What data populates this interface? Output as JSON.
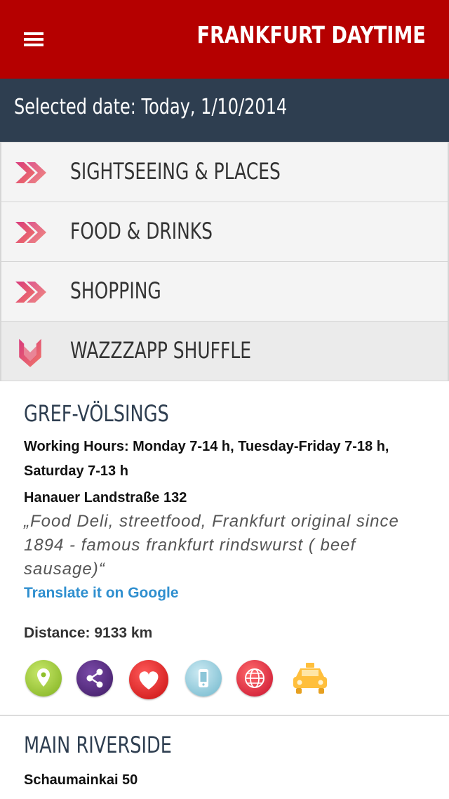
{
  "header": {
    "title": "FRANKFURT DAYTIME",
    "menu_icon": "hamburger-menu-icon"
  },
  "date_bar": {
    "text": "Selected date: Today, 1/10/2014"
  },
  "categories": [
    {
      "label": "SIGHTSEEING & PLACES",
      "icon": "chevron-right-icon",
      "expanded": false
    },
    {
      "label": "FOOD & DRINKS",
      "icon": "chevron-right-icon",
      "expanded": false
    },
    {
      "label": "SHOPPING",
      "icon": "chevron-right-icon",
      "expanded": false
    },
    {
      "label": "WAZZZAPP SHUFFLE",
      "icon": "chevron-down-icon",
      "expanded": true
    }
  ],
  "venues": [
    {
      "name": "GREF-VÖLSINGS",
      "hours": "Working Hours: Monday 7-14 h, Tuesday-Friday 7-18 h, Saturday 7-13 h",
      "address": "Hanauer Landstraße 132",
      "description": "„Food Deli, streetfood, Frankfurt original since 1894 - famous frankfurt rindswurst ( beef sausage)“",
      "translate_link": "Translate it on Google",
      "distance": "Distance: 9133 km",
      "actions": [
        "map-pin-icon",
        "share-icon",
        "heart-icon",
        "phone-icon",
        "globe-icon",
        "taxi-icon"
      ]
    },
    {
      "name": "MAIN RIVERSIDE",
      "address": "Schaumainkai 50"
    }
  ],
  "colors": {
    "header": "#b50000",
    "date_bar": "#2e3e50",
    "link": "#2f8fcf",
    "chevron_start": "#d83a7c",
    "chevron_end": "#f0776a"
  }
}
